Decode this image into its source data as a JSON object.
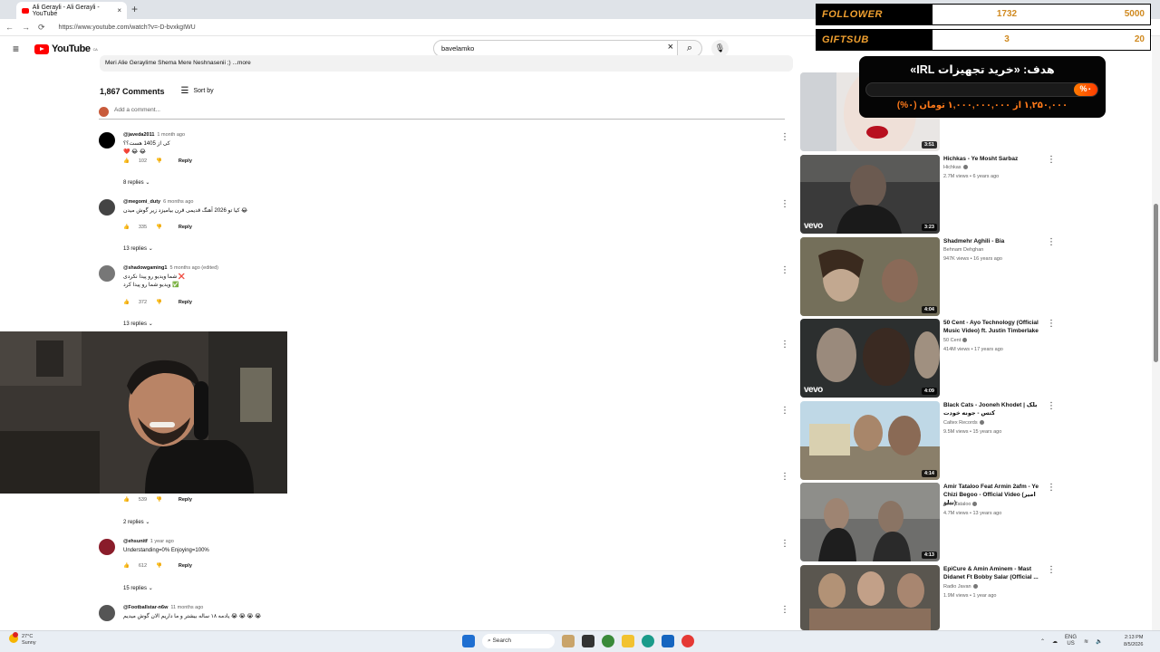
{
  "browser": {
    "tab_title": "Ali Gerayli - Ali Gerayli - YouTube",
    "url": "https://www.youtube.com/watch?v=-D-bvxkgIWU"
  },
  "youtube": {
    "logo_text": "YouTube",
    "region": "CA",
    "search_value": "bavelamko",
    "description": "Meri Alie Geraylime Shema Mere Neshnasenii ;) ...more",
    "comment_count": "1,867 Comments",
    "sort_label": "Sort by",
    "add_comment_placeholder": "Add a comment..."
  },
  "comments": [
    {
      "user": "@javeda2011",
      "time": "1 month ago",
      "body": "کی از 1405 هست؟؟\n❤️ 😂 😂",
      "likes": "102",
      "reply": "Reply",
      "replies": "8 replies"
    },
    {
      "user": "@megomi_duty",
      "time": "6 months ago",
      "body": "کیا تو 2026 آهنگ قدیمی قرن بیامیزد زیر گوش میدن 😂",
      "likes": "335",
      "reply": "Reply",
      "replies": "13 replies"
    },
    {
      "user": "@shadowgaming1",
      "time": "5 months ago (edited)",
      "body": "شما ویدیو رو پیدا نکردی ❌\nویدیو شما رو پیدا کرد ✅",
      "likes": "372",
      "reply": "Reply",
      "replies": "13 replies"
    },
    {
      "user": "",
      "time": "",
      "body": "",
      "likes": "539",
      "reply": "Reply",
      "replies": "2 replies"
    },
    {
      "user": "@ehsunitf",
      "time": "1 year ago",
      "body": "Understanding=0% Enjoying=100%",
      "likes": "612",
      "reply": "Reply",
      "replies": "15 replies"
    },
    {
      "user": "@Footballstar-n6w",
      "time": "11 months ago",
      "body": "یادمه ۱۸ ساله بیشتر و ما داریم الان گوش میدیم 😭 😭 😭 😭",
      "likes": "",
      "reply": "",
      "replies": ""
    }
  ],
  "recommendations": [
    {
      "title": "",
      "channel": "",
      "stats": "",
      "duration": "3:51"
    },
    {
      "title": "Hichkas - Ye Mosht Sarbaz",
      "channel": "Hichkas",
      "stats": "2.7M views • 6 years ago",
      "duration": "3:23"
    },
    {
      "title": "Shadmehr Aghili - Bia",
      "channel": "Behnam Dehghan",
      "stats": "947K views • 16 years ago",
      "duration": "4:04"
    },
    {
      "title": "50 Cent - Ayo Technology (Official Music Video) ft. Justin Timberlake",
      "channel": "50 Cent",
      "stats": "414M views • 17 years ago",
      "duration": "4:09"
    },
    {
      "title": "Black Cats - Jooneh Khodet | بلک کتس - جونه خودت",
      "channel": "Caltex Records",
      "stats": "9.5M views • 15 years ago",
      "duration": "4:14"
    },
    {
      "title": "Amir Tataloo Feat Armin 2afm - Ye Chizi Begoo - Official Video (امیر تتلو)",
      "channel": "Amir Tataloo",
      "stats": "4.7M views • 13 years ago",
      "duration": "4:13"
    },
    {
      "title": "EpiCure & Amin Aminem - Mast Didanet Ft Bobby Salar (Official ...",
      "channel": "Radio Javan",
      "stats": "1.9M views • 1 year ago",
      "duration": ""
    }
  ],
  "overlay": {
    "follower_label": "FOLLOWER",
    "follower_current": "1732",
    "follower_goal": "5000",
    "follower_progress": 0.3464,
    "giftsub_label": "GIFTSUB",
    "giftsub_current": "3",
    "giftsub_goal": "20",
    "giftsub_progress": 0.15,
    "goal_title": "هدف: «خرید تجهیزات IRL»",
    "goal_percent": "%۰",
    "goal_amount": "۱,۲۵۰,۰۰۰ از ۱,۰۰۰,۰۰۰,۰۰۰ تومان (۰%)"
  },
  "taskbar": {
    "temperature": "27°C",
    "weather": "Sunny",
    "search_label": "Search",
    "lang": "ENG",
    "region": "US",
    "time": "2:13 PM",
    "date": "8/5/2026",
    "badge": "1"
  }
}
